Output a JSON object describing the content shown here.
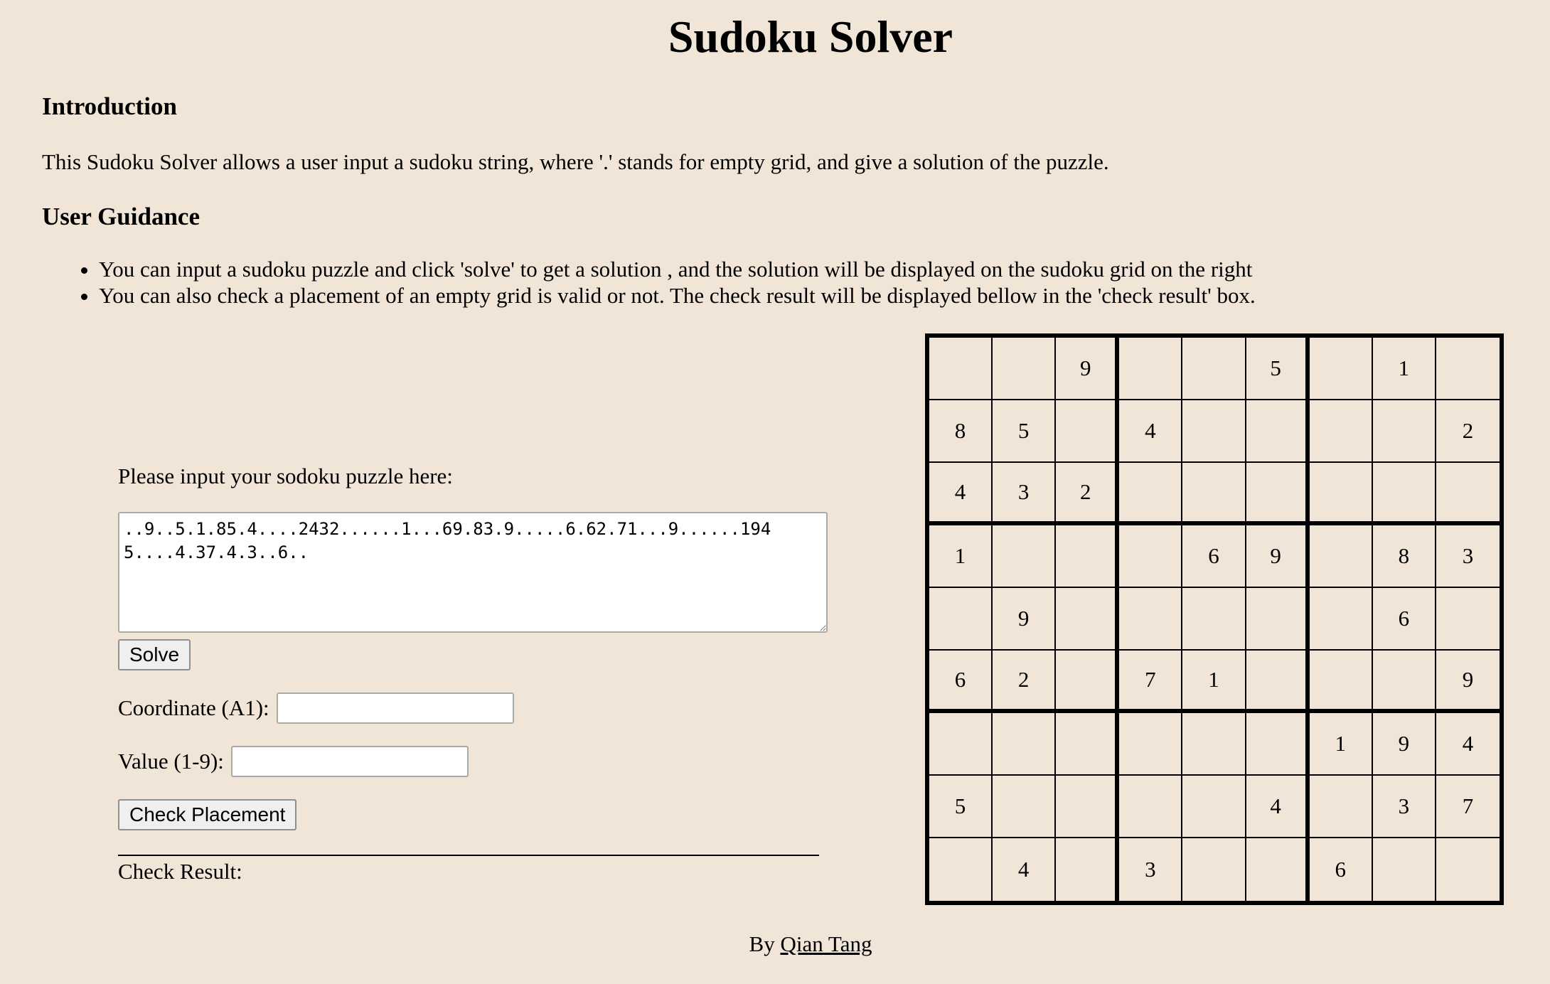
{
  "page": {
    "title": "Sudoku Solver"
  },
  "intro": {
    "heading": "Introduction",
    "text": "This Sudoku Solver allows a user input a sudoku string, where '.' stands for empty grid, and give a solution of the puzzle."
  },
  "guidance": {
    "heading": "User Guidance",
    "items": [
      "You can input a sudoku puzzle and click 'solve' to get a solution , and the solution will be displayed on the sudoku grid on the right",
      "You can also check a placement of an empty grid is valid or not. The check result will be displayed bellow in the 'check result' box."
    ]
  },
  "form": {
    "puzzle_label": "Please input your sodoku puzzle here:",
    "puzzle_value": "..9..5.1.85.4....2432......1...69.83.9.....6.62.71...9......1945....4.37.4.3..6..",
    "solve_label": "Solve",
    "coordinate_label": "Coordinate (A1):",
    "coordinate_value": "",
    "value_label": "Value (1-9):",
    "value_value": "",
    "check_label": "Check Placement",
    "result_label": "Check Result:",
    "result_value": ""
  },
  "grid": {
    "rows": [
      [
        "",
        "",
        "9",
        "",
        "",
        "5",
        "",
        "1",
        ""
      ],
      [
        "8",
        "5",
        "",
        "4",
        "",
        "",
        "",
        "",
        "2"
      ],
      [
        "4",
        "3",
        "2",
        "",
        "",
        "",
        "",
        "",
        ""
      ],
      [
        "1",
        "",
        "",
        "",
        "6",
        "9",
        "",
        "8",
        "3"
      ],
      [
        "",
        "9",
        "",
        "",
        "",
        "",
        "",
        "6",
        ""
      ],
      [
        "6",
        "2",
        "",
        "7",
        "1",
        "",
        "",
        "",
        "9"
      ],
      [
        "",
        "",
        "",
        "",
        "",
        "",
        "1",
        "9",
        "4"
      ],
      [
        "5",
        "",
        "",
        "",
        "",
        "4",
        "",
        "3",
        "7"
      ],
      [
        "",
        "4",
        "",
        "3",
        "",
        "",
        "6",
        "",
        ""
      ]
    ]
  },
  "footer": {
    "by_text": "By",
    "author": "Qian Tang"
  }
}
